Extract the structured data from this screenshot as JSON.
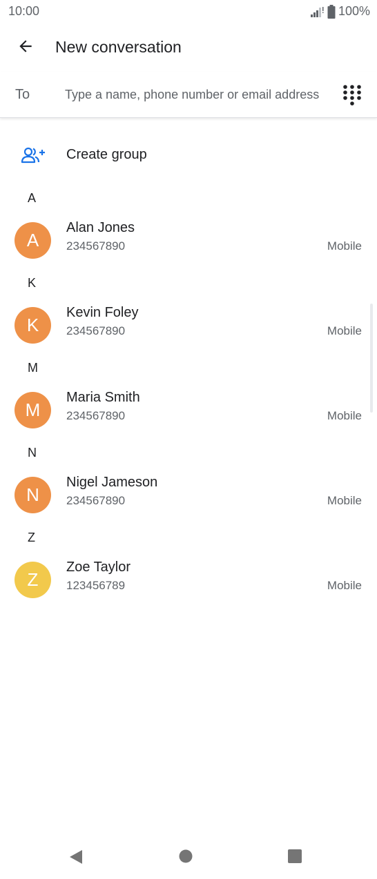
{
  "status_bar": {
    "time": "10:00",
    "battery": "100%"
  },
  "app_bar": {
    "title": "New conversation"
  },
  "to_field": {
    "label": "To",
    "placeholder": "Type a name, phone number or email address",
    "value": ""
  },
  "create_group": {
    "label": "Create group"
  },
  "sections": [
    {
      "letter": "A",
      "contacts": [
        {
          "initial": "A",
          "name": "Alan Jones",
          "number": "234567890",
          "type": "Mobile",
          "color": "#EE9148"
        }
      ]
    },
    {
      "letter": "K",
      "contacts": [
        {
          "initial": "K",
          "name": "Kevin Foley",
          "number": "234567890",
          "type": "Mobile",
          "color": "#EE9148"
        }
      ]
    },
    {
      "letter": "M",
      "contacts": [
        {
          "initial": "M",
          "name": "Maria Smith",
          "number": "234567890",
          "type": "Mobile",
          "color": "#EE9148"
        }
      ]
    },
    {
      "letter": "N",
      "contacts": [
        {
          "initial": "N",
          "name": "Nigel Jameson",
          "number": "234567890",
          "type": "Mobile",
          "color": "#EE9148"
        }
      ]
    },
    {
      "letter": "Z",
      "contacts": [
        {
          "initial": "Z",
          "name": "Zoe Taylor",
          "number": "123456789",
          "type": "Mobile",
          "color": "#F2C94C"
        }
      ]
    }
  ],
  "colors": {
    "accent": "#1A73E8",
    "text_primary": "#202124",
    "text_secondary": "#5F6368"
  }
}
